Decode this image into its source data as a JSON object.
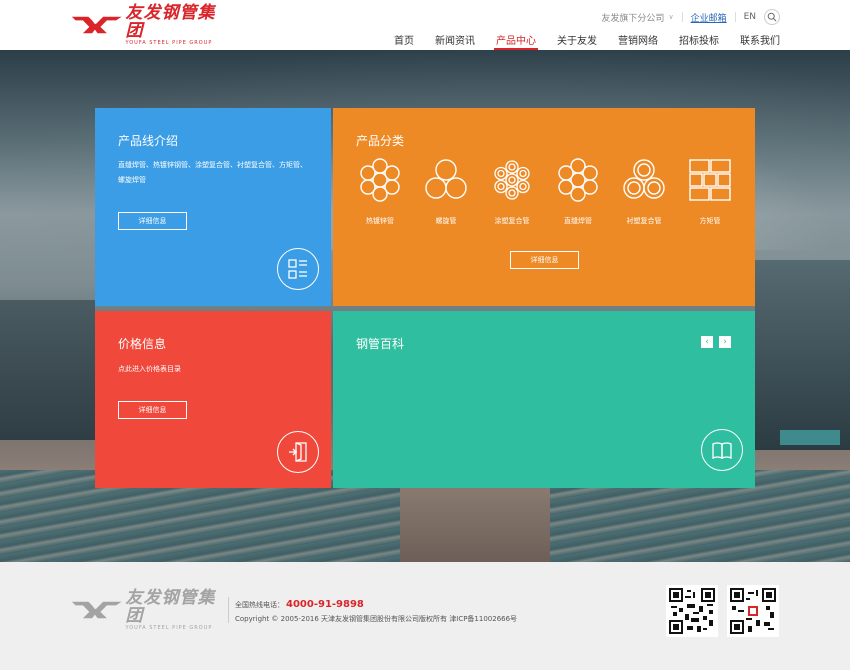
{
  "header": {
    "logo_cn": "友发钢管集团",
    "logo_en": "YOUFA STEEL PIPE GROUP",
    "top_links": {
      "subsidiaries": "友发旗下分公司",
      "mail": "企业邮箱",
      "lang": "EN"
    },
    "nav": [
      {
        "label": "首页",
        "active": false
      },
      {
        "label": "新闻资讯",
        "active": false
      },
      {
        "label": "产品中心",
        "active": true
      },
      {
        "label": "关于友发",
        "active": false
      },
      {
        "label": "营销网络",
        "active": false
      },
      {
        "label": "招标投标",
        "active": false
      },
      {
        "label": "联系我们",
        "active": false
      }
    ],
    "accent_color": "#d9252a"
  },
  "tiles": {
    "product_line": {
      "title": "产品线介绍",
      "desc": "直缝焊管、热镀锌钢管、涂塑复合管、衬塑复合管、方矩管、螺旋焊管",
      "button": "详细信息",
      "icon": "grid-list-icon",
      "color": "#3a9de6"
    },
    "categories": {
      "title": "产品分类",
      "items": [
        {
          "label": "热镀锌管",
          "icon": "hot-dip-pipe-icon"
        },
        {
          "label": "螺旋管",
          "icon": "spiral-pipe-icon"
        },
        {
          "label": "涂塑复合管",
          "icon": "coated-pipe-icon"
        },
        {
          "label": "直缝焊管",
          "icon": "welded-pipe-icon"
        },
        {
          "label": "衬塑复合管",
          "icon": "lined-pipe-icon"
        },
        {
          "label": "方矩管",
          "icon": "square-pipe-icon"
        }
      ],
      "button": "详细信息",
      "color": "#ee8a26"
    },
    "price": {
      "title": "价格信息",
      "desc": "点此进入价格表目录",
      "button": "详细信息",
      "icon": "door-enter-icon",
      "color": "#f0483b"
    },
    "encyclopedia": {
      "title": "钢管百科",
      "prev": "‹",
      "next": "›",
      "icon": "book-icon",
      "color": "#2fbfa0"
    }
  },
  "footer": {
    "logo_cn": "友发钢管集团",
    "logo_en": "YOUFA STEEL PIPE GROUP",
    "hotline_label": "全国热线电话：",
    "hotline": "4000-91-9898",
    "copyright": "Copyright © 2005-2016 天津友发钢管集团股份有限公司版权所有 津ICP备11002666号"
  }
}
